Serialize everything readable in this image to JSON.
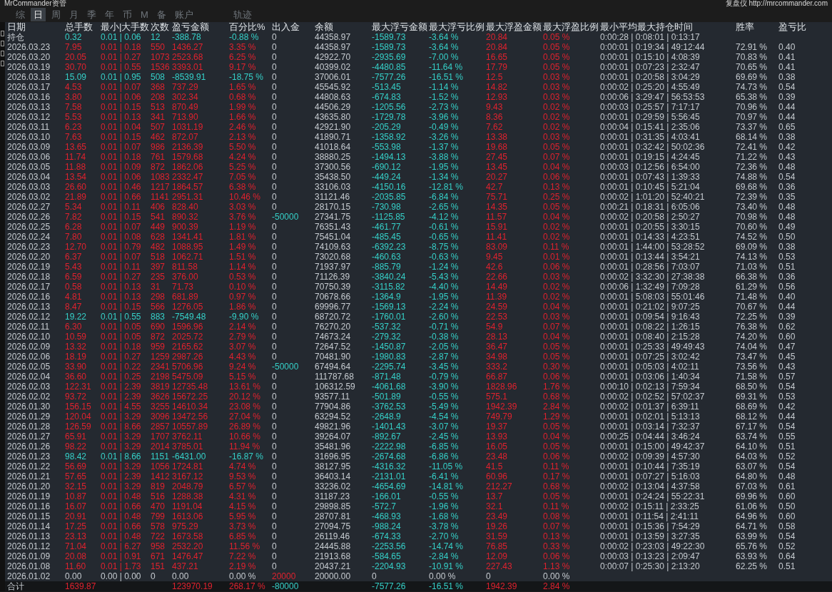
{
  "window": {
    "title": "MrCommander资管",
    "header_right": "复盘仪 http://mrcommander.com"
  },
  "tabs": [
    {
      "label": "综",
      "selected": false
    },
    {
      "label": "日",
      "selected": true
    },
    {
      "label": "周",
      "selected": false
    },
    {
      "label": "月",
      "selected": false
    },
    {
      "label": "季",
      "selected": false
    },
    {
      "label": "年",
      "selected": false
    },
    {
      "label": "币",
      "selected": false
    },
    {
      "label": "M",
      "selected": false
    },
    {
      "label": "备",
      "selected": false
    },
    {
      "label": "账户",
      "selected": false
    },
    {
      "label": "轨迹",
      "selected": false
    }
  ],
  "table": {
    "columns": [
      "日期",
      "总手数",
      "最小|大手数",
      "次数",
      "盈亏金额",
      "百分比%",
      "出入金",
      "余额",
      "最大浮亏金额",
      "最大浮亏比例",
      "最大浮盈金额",
      "最大浮盈比例",
      "最小平均最大持仓时间",
      "胜率",
      "盈亏比"
    ],
    "rows": [
      {
        "kind": "loss",
        "cells": [
          "持仓",
          "0.32",
          "0.01 | 0.06",
          "12",
          "-388.78",
          "-0.88 %",
          "0",
          "44358.97",
          "-1589.73",
          "-3.64 %",
          "20.84",
          "0.05 %",
          "0:00:28 | 0:08:01 | 0:13:17",
          null,
          null
        ]
      },
      {
        "kind": "gain",
        "cells": [
          "2026.03.23",
          "7.95",
          "0.01 | 0.18",
          "550",
          "1436.27",
          "3.35 %",
          "0",
          "44358.97",
          "-1589.73",
          "-3.64 %",
          "20.84",
          "0.05 %",
          "0:00:01 | 0:19:34 | 49:12:44",
          "72.91 %",
          "0.40"
        ]
      },
      {
        "kind": "gain",
        "cells": [
          "2026.03.20",
          "20.05",
          "0.01 | 0.27",
          "1073",
          "2523.68",
          "6.25 %",
          "0",
          "42922.70",
          "-2935.69",
          "-7.00 %",
          "16.65",
          "0.05 %",
          "0:00:01 | 0:15:10 | 4:08:39",
          "70.83 %",
          "0.41"
        ]
      },
      {
        "kind": "gain",
        "cells": [
          "2026.03.19",
          "30.70",
          "0.01 | 0.55",
          "1536",
          "3393.01",
          "9.17 %",
          "0",
          "40399.02",
          "-4480.85",
          "-11.64 %",
          "17.79",
          "0.05 %",
          "0:00:01 | 0:07:23 | 2:32:47",
          "70.65 %",
          "0.41"
        ]
      },
      {
        "kind": "loss",
        "cells": [
          "2026.03.18",
          "15.09",
          "0.01 | 0.95",
          "508",
          "-8539.91",
          "-18.75 %",
          "0",
          "37006.01",
          "-7577.26",
          "-16.51 %",
          "12.5",
          "0.03 %",
          "0:00:01 | 0:20:58 | 3:04:29",
          "69.69 %",
          "0.38"
        ]
      },
      {
        "kind": "gain",
        "cells": [
          "2026.03.17",
          "4.53",
          "0.01 | 0.07",
          "368",
          "737.29",
          "1.65 %",
          "0",
          "45545.92",
          "-513.45",
          "-1.14 %",
          "14.82",
          "0.03 %",
          "0:00:02 | 0:25:20 | 4:55:49",
          "74.73 %",
          "0.54"
        ]
      },
      {
        "kind": "gain",
        "cells": [
          "2026.03.16",
          "3.80",
          "0.01 | 0.06",
          "208",
          "302.34",
          "0.68 %",
          "0",
          "44808.63",
          "-674.83",
          "-1.52 %",
          "12.93",
          "0.03 %",
          "0:00:06 | 3:29:47 | 56:53:53",
          "65.38 %",
          "0.39"
        ]
      },
      {
        "kind": "gain",
        "cells": [
          "2026.03.13",
          "7.58",
          "0.01 | 0.15",
          "513",
          "870.49",
          "1.99 %",
          "0",
          "44506.29",
          "-1205.56",
          "-2.73 %",
          "9.43",
          "0.02 %",
          "0:00:03 | 0:25:57 | 7:17:17",
          "70.96 %",
          "0.44"
        ]
      },
      {
        "kind": "gain",
        "cells": [
          "2026.03.12",
          "5.53",
          "0.01 | 0.13",
          "341",
          "713.90",
          "1.66 %",
          "0",
          "43635.80",
          "-1729.78",
          "-3.96 %",
          "8.36",
          "0.02 %",
          "0:00:01 | 0:29:59 | 5:56:45",
          "70.97 %",
          "0.44"
        ]
      },
      {
        "kind": "gain",
        "cells": [
          "2026.03.11",
          "6.23",
          "0.01 | 0.04",
          "507",
          "1031.19",
          "2.46 %",
          "0",
          "42921.90",
          "-205.29",
          "-0.49 %",
          "7.62",
          "0.02 %",
          "0:00:04 | 0:15:41 | 2:35:06",
          "73.37 %",
          "0.65"
        ]
      },
      {
        "kind": "gain",
        "cells": [
          "2026.03.10",
          "7.63",
          "0.01 | 0.15",
          "462",
          "872.07",
          "2.13 %",
          "0",
          "41890.71",
          "-1358.92",
          "-3.26 %",
          "13.38",
          "0.03 %",
          "0:00:01 | 0:31:35 | 4:03:41",
          "68.14 %",
          "0.38"
        ]
      },
      {
        "kind": "gain",
        "cells": [
          "2026.03.09",
          "13.65",
          "0.01 | 0.07",
          "986",
          "2136.39",
          "5.50 %",
          "0",
          "41018.64",
          "-553.98",
          "-1.37 %",
          "19.68",
          "0.05 %",
          "0:00:01 | 0:32:42 | 50:02:36",
          "72.41 %",
          "0.42"
        ]
      },
      {
        "kind": "gain",
        "cells": [
          "2026.03.06",
          "11.74",
          "0.01 | 0.18",
          "761",
          "1579.68",
          "4.24 %",
          "0",
          "38880.25",
          "-1494.13",
          "-3.88 %",
          "27.45",
          "0.07 %",
          "0:00:01 | 0:19:15 | 4:24:45",
          "71.22 %",
          "0.43"
        ]
      },
      {
        "kind": "gain",
        "cells": [
          "2026.03.05",
          "11.88",
          "0.01 | 0.09",
          "872",
          "1862.06",
          "5.25 %",
          "0",
          "37300.56",
          "-690.12",
          "-1.95 %",
          "13.45",
          "0.04 %",
          "0:00:03 | 0:12:56 | 6:54:00",
          "72.36 %",
          "0.48"
        ]
      },
      {
        "kind": "gain",
        "cells": [
          "2026.03.04",
          "13.54",
          "0.01 | 0.06",
          "1083",
          "2332.47",
          "7.05 %",
          "0",
          "35438.50",
          "-449.24",
          "-1.34 %",
          "20.27",
          "0.06 %",
          "0:00:01 | 0:07:43 | 1:39:33",
          "74.88 %",
          "0.54"
        ]
      },
      {
        "kind": "gain",
        "cells": [
          "2026.03.03",
          "26.60",
          "0.01 | 0.46",
          "1217",
          "1864.57",
          "6.38 %",
          "0",
          "33106.03",
          "-4150.16",
          "-12.81 %",
          "42.7",
          "0.13 %",
          "0:00:01 | 0:10:45 | 5:21:04",
          "69.68 %",
          "0.36"
        ]
      },
      {
        "kind": "gain",
        "cells": [
          "2026.03.02",
          "21.89",
          "0.01 | 0.66",
          "1141",
          "2951.31",
          "10.46 %",
          "0",
          "31121.46",
          "-2035.85",
          "-6.84 %",
          "75.71",
          "0.25 %",
          "0:00:02 | 1:01:20 | 52:40:21",
          "72.39 %",
          "0.35"
        ]
      },
      {
        "kind": "gain",
        "cells": [
          "2026.02.27",
          "5.34",
          "0.01 | 0.11",
          "406",
          "828.40",
          "3.03 %",
          "0",
          "28170.15",
          "-730.98",
          "-2.65 %",
          "14.35",
          "0.05 %",
          "0:00:21 | 0:18:31 | 6:05:06",
          "73.40 %",
          "0.48"
        ]
      },
      {
        "kind": "gain_out",
        "cells": [
          "2026.02.26",
          "7.82",
          "0.01 | 0.15",
          "541",
          "890.32",
          "3.76 %",
          "-50000",
          "27341.75",
          "-1125.85",
          "-4.12 %",
          "11.57",
          "0.04 %",
          "0:00:02 | 0:20:58 | 2:50:27",
          "70.98 %",
          "0.48"
        ]
      },
      {
        "kind": "gain",
        "cells": [
          "2026.02.25",
          "6.28",
          "0.01 | 0.07",
          "449",
          "900.39",
          "1.19 %",
          "0",
          "76351.43",
          "-461.77",
          "-0.61 %",
          "15.91",
          "0.02 %",
          "0:00:01 | 0:20:55 | 3:30:15",
          "70.60 %",
          "0.49"
        ]
      },
      {
        "kind": "gain",
        "cells": [
          "2026.02.24",
          "7.80",
          "0.01 | 0.08",
          "628",
          "1341.41",
          "1.81 %",
          "0",
          "75451.04",
          "-485.45",
          "-0.65 %",
          "11.41",
          "0.02 %",
          "0:00:01 | 0:14:33 | 4:23:51",
          "74.52 %",
          "0.50"
        ]
      },
      {
        "kind": "gain",
        "cells": [
          "2026.02.23",
          "12.70",
          "0.01 | 0.79",
          "482",
          "1088.95",
          "1.49 %",
          "0",
          "74109.63",
          "-6392.23",
          "-8.75 %",
          "83.09",
          "0.11 %",
          "0:00:01 | 1:44:00 | 53:28:52",
          "69.09 %",
          "0.38"
        ]
      },
      {
        "kind": "gain",
        "cells": [
          "2026.02.20",
          "6.37",
          "0.01 | 0.07",
          "518",
          "1062.71",
          "1.51 %",
          "0",
          "73020.68",
          "-460.63",
          "-0.63 %",
          "9.45",
          "0.01 %",
          "0:00:01 | 0:13:44 | 3:54:21",
          "74.13 %",
          "0.53"
        ]
      },
      {
        "kind": "gain",
        "cells": [
          "2026.02.19",
          "5.43",
          "0.01 | 0.11",
          "397",
          "811.58",
          "1.14 %",
          "0",
          "71937.97",
          "-885.79",
          "-1.24 %",
          "42.6",
          "0.06 %",
          "0:00:01 | 0:28:56 | 7:03:07",
          "71.03 %",
          "0.51"
        ]
      },
      {
        "kind": "gain",
        "cells": [
          "2026.02.18",
          "6.59",
          "0.01 | 0.27",
          "235",
          "376.00",
          "0.53 %",
          "0",
          "71126.39",
          "-3840.24",
          "-5.43 %",
          "22.66",
          "0.03 %",
          "0:00:02 | 3:32:30 | 27:38:38",
          "66.38 %",
          "0.36"
        ]
      },
      {
        "kind": "gain",
        "cells": [
          "2026.02.17",
          "0.58",
          "0.01 | 0.13",
          "31",
          "71.73",
          "0.10 %",
          "0",
          "70750.39",
          "-3115.82",
          "-4.40 %",
          "14.49",
          "0.02 %",
          "0:00:06 | 1:32:49 | 7:09:28",
          "61.29 %",
          "0.56"
        ]
      },
      {
        "kind": "gain",
        "cells": [
          "2026.02.16",
          "4.81",
          "0.01 | 0.13",
          "298",
          "681.89",
          "0.97 %",
          "0",
          "70678.66",
          "-1364.9",
          "-1.95 %",
          "11.39",
          "0.02 %",
          "0:00:01 | 5:08:03 | 55:01:46",
          "71.48 %",
          "0.40"
        ]
      },
      {
        "kind": "gain",
        "cells": [
          "2026.02.13",
          "8.47",
          "0.01 | 0.15",
          "566",
          "1276.05",
          "1.86 %",
          "0",
          "69996.77",
          "-1569.13",
          "-2.24 %",
          "24.59",
          "0.04 %",
          "0:00:01 | 0:21:02 | 9:07:25",
          "70.67 %",
          "0.44"
        ]
      },
      {
        "kind": "loss",
        "cells": [
          "2026.02.12",
          "19.22",
          "0.01 | 0.55",
          "883",
          "-7549.48",
          "-9.90 %",
          "0",
          "68720.72",
          "-1760.01",
          "-2.60 %",
          "22.53",
          "0.03 %",
          "0:00:01 | 0:09:54 | 9:16:43",
          "72.25 %",
          "0.39"
        ]
      },
      {
        "kind": "gain",
        "cells": [
          "2026.02.11",
          "6.30",
          "0.01 | 0.05",
          "690",
          "1596.96",
          "2.14 %",
          "0",
          "76270.20",
          "-537.32",
          "-0.71 %",
          "54.9",
          "0.07 %",
          "0:00:01 | 0:08:22 | 1:26:15",
          "76.38 %",
          "0.62"
        ]
      },
      {
        "kind": "gain",
        "cells": [
          "2026.02.10",
          "10.59",
          "0.01 | 0.05",
          "872",
          "2025.72",
          "2.79 %",
          "0",
          "74673.24",
          "-279.32",
          "-0.38 %",
          "28.13",
          "0.04 %",
          "0:00:01 | 0:08:40 | 2:15:28",
          "74.20 %",
          "0.60"
        ]
      },
      {
        "kind": "gain",
        "cells": [
          "2026.02.09",
          "13.32",
          "0.01 | 0.18",
          "959",
          "2165.62",
          "3.07 %",
          "0",
          "72647.52",
          "-1450.87",
          "-2.05 %",
          "36.47",
          "0.05 %",
          "0:00:01 | 0:25:33 | 49:49:43",
          "74.04 %",
          "0.47"
        ]
      },
      {
        "kind": "gain",
        "cells": [
          "2026.02.06",
          "18.19",
          "0.01 | 0.27",
          "1259",
          "2987.26",
          "4.43 %",
          "0",
          "70481.90",
          "-1980.83",
          "-2.87 %",
          "34.98",
          "0.05 %",
          "0:00:01 | 0:07:25 | 3:02:42",
          "73.47 %",
          "0.45"
        ]
      },
      {
        "kind": "gain_out",
        "cells": [
          "2026.02.05",
          "33.90",
          "0.01 | 0.22",
          "2341",
          "5706.96",
          "9.24 %",
          "-50000",
          "67494.64",
          "-2295.74",
          "-3.45 %",
          "333.2",
          "0.30 %",
          "0:00:01 | 0:05:03 | 4:02:11",
          "73.56 %",
          "0.43"
        ]
      },
      {
        "kind": "gain",
        "cells": [
          "2026.02.04",
          "36.60",
          "0.01 | 0.25",
          "2198",
          "5475.09",
          "5.15 %",
          "0",
          "111787.68",
          "-871.48",
          "-0.79 %",
          "66.87",
          "0.06 %",
          "0:00:01 | 0:03:06 | 1:40:34",
          "71.58 %",
          "0.57"
        ]
      },
      {
        "kind": "gain",
        "cells": [
          "2026.02.03",
          "122.31",
          "0.01 | 2.39",
          "3819",
          "12735.48",
          "13.61 %",
          "0",
          "106312.59",
          "-4061.68",
          "-3.90 %",
          "1828.96",
          "1.76 %",
          "0:00:10 | 0:02:13 | 7:59:34",
          "68.50 %",
          "0.54"
        ]
      },
      {
        "kind": "gain",
        "cells": [
          "2026.02.02",
          "93.72",
          "0.01 | 2.39",
          "3626",
          "15672.25",
          "20.12 %",
          "0",
          "93577.11",
          "-501.89",
          "-0.55 %",
          "575.1",
          "0.68 %",
          "0:00:02 | 0:02:52 | 57:02:37",
          "69.31 %",
          "0.53"
        ]
      },
      {
        "kind": "gain",
        "cells": [
          "2026.01.30",
          "156.15",
          "0.01 | 4.55",
          "3255",
          "14610.34",
          "23.08 %",
          "0",
          "77904.86",
          "-3762.53",
          "-5.49 %",
          "1942.39",
          "2.84 %",
          "0:00:02 | 0:01:37 | 6:39:11",
          "68.69 %",
          "0.42"
        ]
      },
      {
        "kind": "gain",
        "cells": [
          "2026.01.29",
          "120.04",
          "0.01 | 3.29",
          "3096",
          "13472.56",
          "27.04 %",
          "0",
          "63294.52",
          "-2648.9",
          "-4.54 %",
          "749.79",
          "1.29 %",
          "0:00:01 | 0:02:01 | 5:13:13",
          "68.12 %",
          "0.44"
        ]
      },
      {
        "kind": "gain",
        "cells": [
          "2026.01.28",
          "126.59",
          "0.01 | 8.66",
          "2857",
          "10557.89",
          "26.89 %",
          "0",
          "49821.96",
          "-1401.43",
          "-3.07 %",
          "19.37",
          "0.05 %",
          "0:00:01 | 0:03:14 | 7:32:37",
          "67.17 %",
          "0.54"
        ]
      },
      {
        "kind": "gain",
        "cells": [
          "2026.01.27",
          "65.91",
          "0.01 | 3.29",
          "1707",
          "3762.11",
          "10.66 %",
          "0",
          "39264.07",
          "-892.67",
          "-2.45 %",
          "13.93",
          "0.04 %",
          "0:00:25 | 0:04:44 | 3:46:24",
          "63.74 %",
          "0.55"
        ]
      },
      {
        "kind": "gain",
        "cells": [
          "2026.01.26",
          "98.22",
          "0.01 | 3.29",
          "2014",
          "3785.01",
          "11.94 %",
          "0",
          "35481.96",
          "-2222.98",
          "-6.85 %",
          "16.05",
          "0.05 %",
          "0:00:01 | 0:15:00 | 49:42:37",
          "64.10 %",
          "0.51"
        ]
      },
      {
        "kind": "loss",
        "cells": [
          "2026.01.23",
          "98.42",
          "0.01 | 8.66",
          "1151",
          "-6431.00",
          "-16.87 %",
          "0",
          "31696.95",
          "-2674.68",
          "-6.86 %",
          "23.48",
          "0.06 %",
          "0:00:02 | 0:09:39 | 4:57:30",
          "64.03 %",
          "0.52"
        ]
      },
      {
        "kind": "gain",
        "cells": [
          "2026.01.22",
          "56.69",
          "0.01 | 3.29",
          "1056",
          "1724.81",
          "4.74 %",
          "0",
          "38127.95",
          "-4316.32",
          "-11.05 %",
          "41.5",
          "0.11 %",
          "0:00:01 | 0:10:44 | 7:35:19",
          "63.07 %",
          "0.54"
        ]
      },
      {
        "kind": "gain",
        "cells": [
          "2026.01.21",
          "57.65",
          "0.01 | 2.39",
          "1412",
          "3167.12",
          "9.53 %",
          "0",
          "36403.14",
          "-2131.01",
          "-6.41 %",
          "60.96",
          "0.17 %",
          "0:00:01 | 0:07:27 | 5:16:03",
          "64.80 %",
          "0.48"
        ]
      },
      {
        "kind": "gain",
        "cells": [
          "2026.01.20",
          "32.15",
          "0.01 | 3.29",
          "819",
          "2048.79",
          "6.57 %",
          "0",
          "33236.02",
          "-4654.69",
          "-14.81 %",
          "212.27",
          "0.68 %",
          "0:00:02 | 0:13:04 | 4:37:58",
          "67.03 %",
          "0.61"
        ]
      },
      {
        "kind": "gain",
        "cells": [
          "2026.01.19",
          "10.87",
          "0.01 | 0.48",
          "516",
          "1288.38",
          "4.31 %",
          "0",
          "31187.23",
          "-166.01",
          "-0.55 %",
          "13.7",
          "0.05 %",
          "0:00:01 | 0:24:24 | 55:22:31",
          "69.96 %",
          "0.60"
        ]
      },
      {
        "kind": "gain",
        "cells": [
          "2026.01.16",
          "16.07",
          "0.01 | 0.66",
          "470",
          "1191.04",
          "4.15 %",
          "0",
          "29898.85",
          "-572.7",
          "-1.96 %",
          "32.1",
          "0.11 %",
          "0:00:02 | 0:15:11 | 2:33:25",
          "61.06 %",
          "0.50"
        ]
      },
      {
        "kind": "gain",
        "cells": [
          "2026.01.15",
          "20.91",
          "0.01 | 0.48",
          "799",
          "1613.06",
          "5.95 %",
          "0",
          "28707.81",
          "-468.93",
          "-1.68 %",
          "23.49",
          "0.08 %",
          "0:00:01 | 0:11:54 | 2:41:11",
          "64.96 %",
          "0.60"
        ]
      },
      {
        "kind": "gain",
        "cells": [
          "2026.01.14",
          "17.25",
          "0.01 | 0.66",
          "578",
          "975.29",
          "3.73 %",
          "0",
          "27094.75",
          "-988.24",
          "-3.78 %",
          "19.26",
          "0.07 %",
          "0:00:01 | 0:15:36 | 7:54:29",
          "64.71 %",
          "0.58"
        ]
      },
      {
        "kind": "gain",
        "cells": [
          "2026.01.13",
          "23.13",
          "0.01 | 0.48",
          "722",
          "1673.58",
          "6.85 %",
          "0",
          "26119.46",
          "-674.33",
          "-2.70 %",
          "31.59",
          "0.13 %",
          "0:00:01 | 0:13:59 | 3:27:35",
          "63.99 %",
          "0.54"
        ]
      },
      {
        "kind": "gain",
        "cells": [
          "2026.01.12",
          "71.04",
          "0.01 | 6.27",
          "958",
          "2532.20",
          "11.56 %",
          "0",
          "24445.88",
          "-2253.56",
          "-14.74 %",
          "76.85",
          "0.33 %",
          "0:00:02 | 0:23:03 | 49:22:30",
          "65.76 %",
          "0.52"
        ]
      },
      {
        "kind": "gain",
        "cells": [
          "2026.01.09",
          "20.08",
          "0.01 | 0.91",
          "671",
          "1476.47",
          "7.22 %",
          "0",
          "21913.68",
          "-584.65",
          "-2.84 %",
          "12.09",
          "0.06 %",
          "0:00:03 | 0:13:23 | 2:09:47",
          "63.93 %",
          "0.64"
        ]
      },
      {
        "kind": "gain",
        "cells": [
          "2026.01.08",
          "11.60",
          "0.01 | 1.73",
          "151",
          "437.21",
          "2.19 %",
          "0",
          "20437.21",
          "-2204.93",
          "-10.91 %",
          "227.43",
          "1.13 %",
          "0:00:07 | 0:25:30 | 2:13:20",
          "62.25 %",
          "0.51"
        ]
      },
      {
        "kind": "flat_in",
        "cells": [
          "2026.01.02",
          "0.00",
          "0.00 | 0.00",
          "0",
          "0.00",
          "0.00 %",
          "20000",
          "20000.00",
          "0",
          "0.00 %",
          "0",
          "0.00 %",
          null,
          null,
          null
        ]
      }
    ],
    "total": {
      "kind": "gain_out",
      "cells": [
        "合计",
        "1639.87",
        null,
        null,
        "123970.19",
        "268.17 %",
        "-80000",
        null,
        "-7577.26",
        "-16.51 %",
        "1942.39",
        "2.84 %",
        null,
        null,
        null
      ]
    }
  }
}
